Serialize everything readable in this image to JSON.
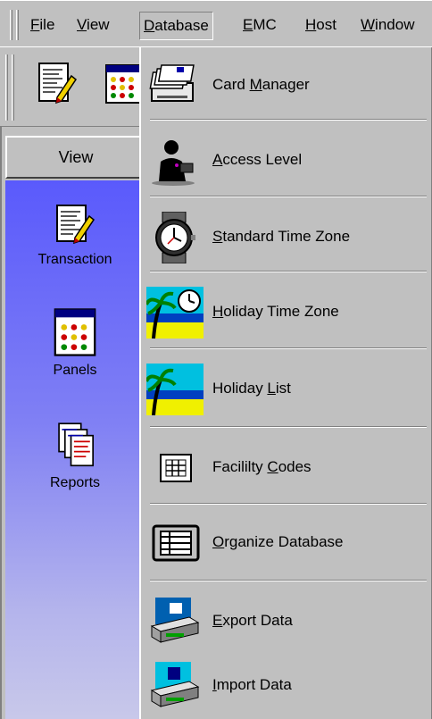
{
  "menubar": {
    "items": [
      {
        "label": "File",
        "u": "F",
        "rest": "ile"
      },
      {
        "label": "View",
        "u": "V",
        "rest": "iew"
      },
      {
        "label": "Database",
        "u": "D",
        "rest": "atabase"
      },
      {
        "label": "EMC",
        "u": "E",
        "rest": "MC"
      },
      {
        "label": "Host",
        "u": "H",
        "rest": "ost"
      },
      {
        "label": "Window",
        "u": "W",
        "rest": "indow"
      }
    ]
  },
  "sidebar": {
    "header": "View",
    "shortcuts": [
      {
        "label": "Transaction",
        "icon": "transaction-icon"
      },
      {
        "label": "Panels",
        "icon": "panels-icon"
      },
      {
        "label": "Reports",
        "icon": "reports-icon"
      }
    ]
  },
  "dropdown": {
    "items": [
      {
        "pre": "Card ",
        "u": "M",
        "post": "anager",
        "icon": "card-manager-icon"
      },
      {
        "pre": "",
        "u": "A",
        "post": "ccess Level",
        "icon": "access-level-icon"
      },
      {
        "pre": "",
        "u": "S",
        "post": "tandard Time Zone",
        "icon": "watch-icon"
      },
      {
        "pre": "",
        "u": "H",
        "post": "oliday Time Zone",
        "icon": "holiday-time-zone-icon"
      },
      {
        "pre": "Holiday ",
        "u": "L",
        "post": "ist",
        "icon": "holiday-list-icon"
      },
      {
        "pre": "Facililty ",
        "u": "C",
        "post": "odes",
        "icon": "facility-codes-icon"
      },
      {
        "pre": "",
        "u": "O",
        "post": "rganize Database",
        "icon": "organize-database-icon"
      },
      {
        "pre": "",
        "u": "E",
        "post": "xport Data",
        "icon": "export-data-icon"
      },
      {
        "pre": "",
        "u": "I",
        "post": "mport Data",
        "icon": "import-data-icon"
      }
    ]
  }
}
